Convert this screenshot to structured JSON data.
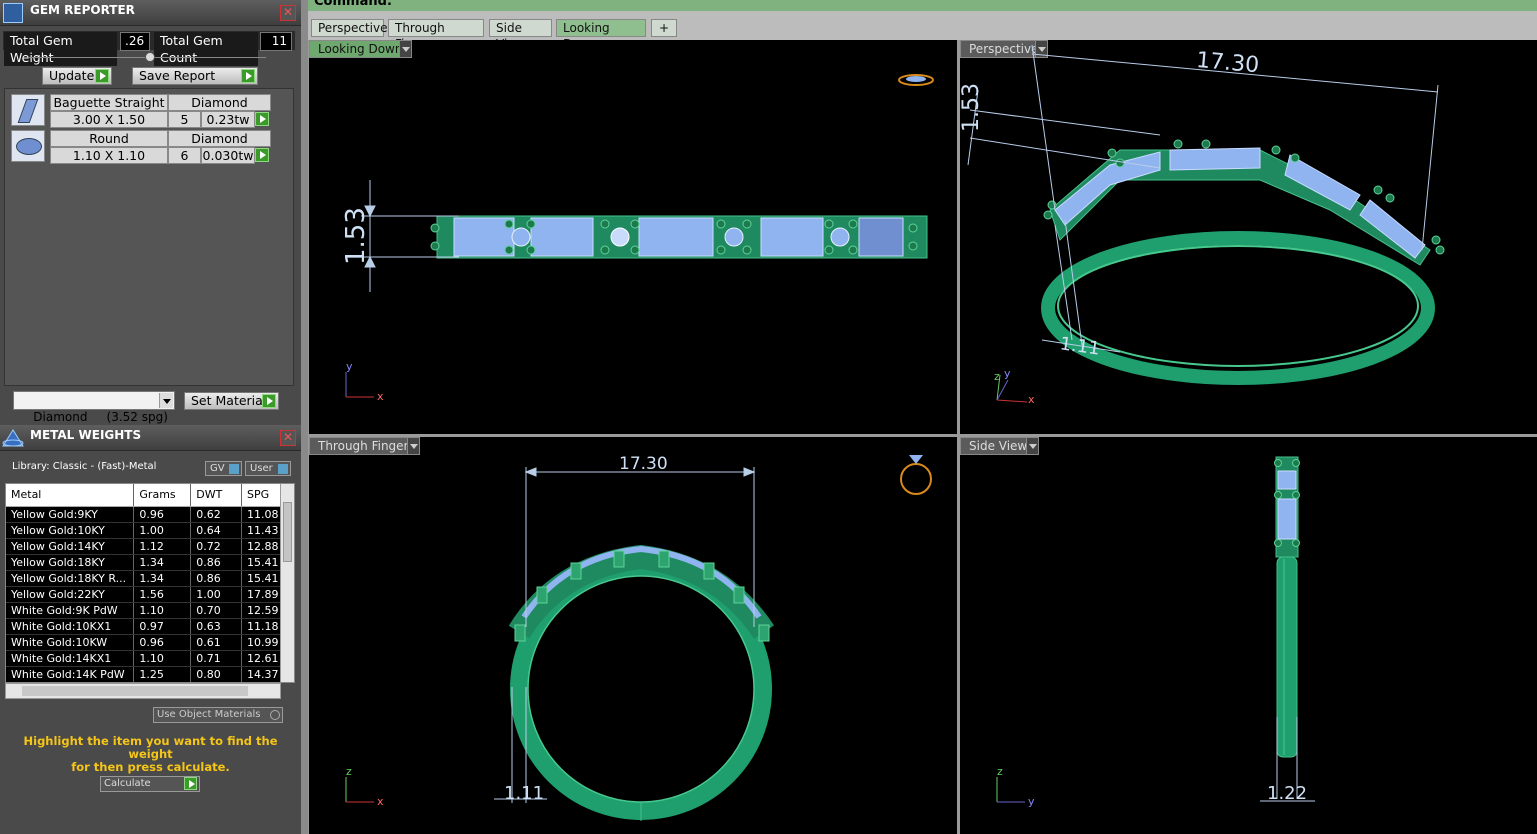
{
  "gem_reporter": {
    "title": "GEM REPORTER",
    "close": "✕",
    "total_weight_label": "Total Gem Weight",
    "total_weight_value": ".26",
    "total_count_label": "Total Gem Count",
    "total_count_value": "11",
    "update_label": "Update",
    "save_report_label": "Save Report",
    "gems": [
      {
        "shape": "Baguette Straight",
        "material": "Diamond",
        "size": "3.00 X 1.50",
        "count": "5",
        "weight": "0.23tw",
        "icon": "baguette-gem-icon"
      },
      {
        "shape": "Round",
        "material": "Diamond",
        "size": "1.10 X 1.10",
        "count": "6",
        "weight": "0.030tw",
        "icon": "round-gem-icon"
      }
    ],
    "material_select": "Diamond     (3.52 spg)",
    "set_material_label": "Set Material"
  },
  "metal_weights": {
    "title": "METAL WEIGHTS",
    "close": "✕",
    "library": "Library: Classic - (Fast)-Metal",
    "gv_label": "GV",
    "user_label": "User",
    "columns": [
      "Metal",
      "Grams",
      "DWT",
      "SPG"
    ],
    "rows": [
      [
        "Yellow Gold:9KY",
        "0.96",
        "0.62",
        "11.08"
      ],
      [
        "Yellow Gold:10KY",
        "1.00",
        "0.64",
        "11.43"
      ],
      [
        "Yellow Gold:14KY",
        "1.12",
        "0.72",
        "12.88"
      ],
      [
        "Yellow Gold:18KY",
        "1.34",
        "0.86",
        "15.41"
      ],
      [
        "Yellow Gold:18KY R...",
        "1.34",
        "0.86",
        "15.41"
      ],
      [
        "Yellow Gold:22KY",
        "1.56",
        "1.00",
        "17.89"
      ],
      [
        "White Gold:9K PdW",
        "1.10",
        "0.70",
        "12.59"
      ],
      [
        "White Gold:10KX1",
        "0.97",
        "0.63",
        "11.18"
      ],
      [
        "White Gold:10KW",
        "0.96",
        "0.61",
        "10.99"
      ],
      [
        "White Gold:14KX1",
        "1.10",
        "0.71",
        "12.61"
      ],
      [
        "White Gold:14K PdW",
        "1.25",
        "0.80",
        "14.37"
      ]
    ],
    "use_object_materials": "Use Object Materials",
    "hint_line1": "Highlight the item you want to find the weight",
    "hint_line2": "for then press calculate.",
    "calculate_label": "Calculate"
  },
  "command": {
    "label": "Command:"
  },
  "tabs": [
    "Perspective",
    "Through Finger",
    "Side View",
    "Looking Down"
  ],
  "tab_add": "+",
  "active_tab": "Looking Down",
  "viewports": {
    "top_left": {
      "label": "Looking Down",
      "dim": "1.53",
      "axis_v": "y",
      "axis_h": "x"
    },
    "top_right": {
      "label": "Perspective",
      "dim_top": "17.30",
      "dim_side": "1.53",
      "dim_bottom": "1.11",
      "axis_v": "z",
      "axis_v2": "y",
      "axis_h": "x"
    },
    "bottom_left": {
      "label": "Through Finger",
      "dim_top": "17.30",
      "dim_bottom": "1.11",
      "axis_v": "z",
      "axis_h": "x"
    },
    "bottom_right": {
      "label": "Side View",
      "dim_bottom": "1.22",
      "axis_v": "z",
      "axis_h": "y"
    }
  },
  "colors": {
    "metal": "#1f9e6e",
    "gem": "#8fb4f0",
    "dim": "#b8cde8",
    "panel": "#4a4a4a"
  }
}
